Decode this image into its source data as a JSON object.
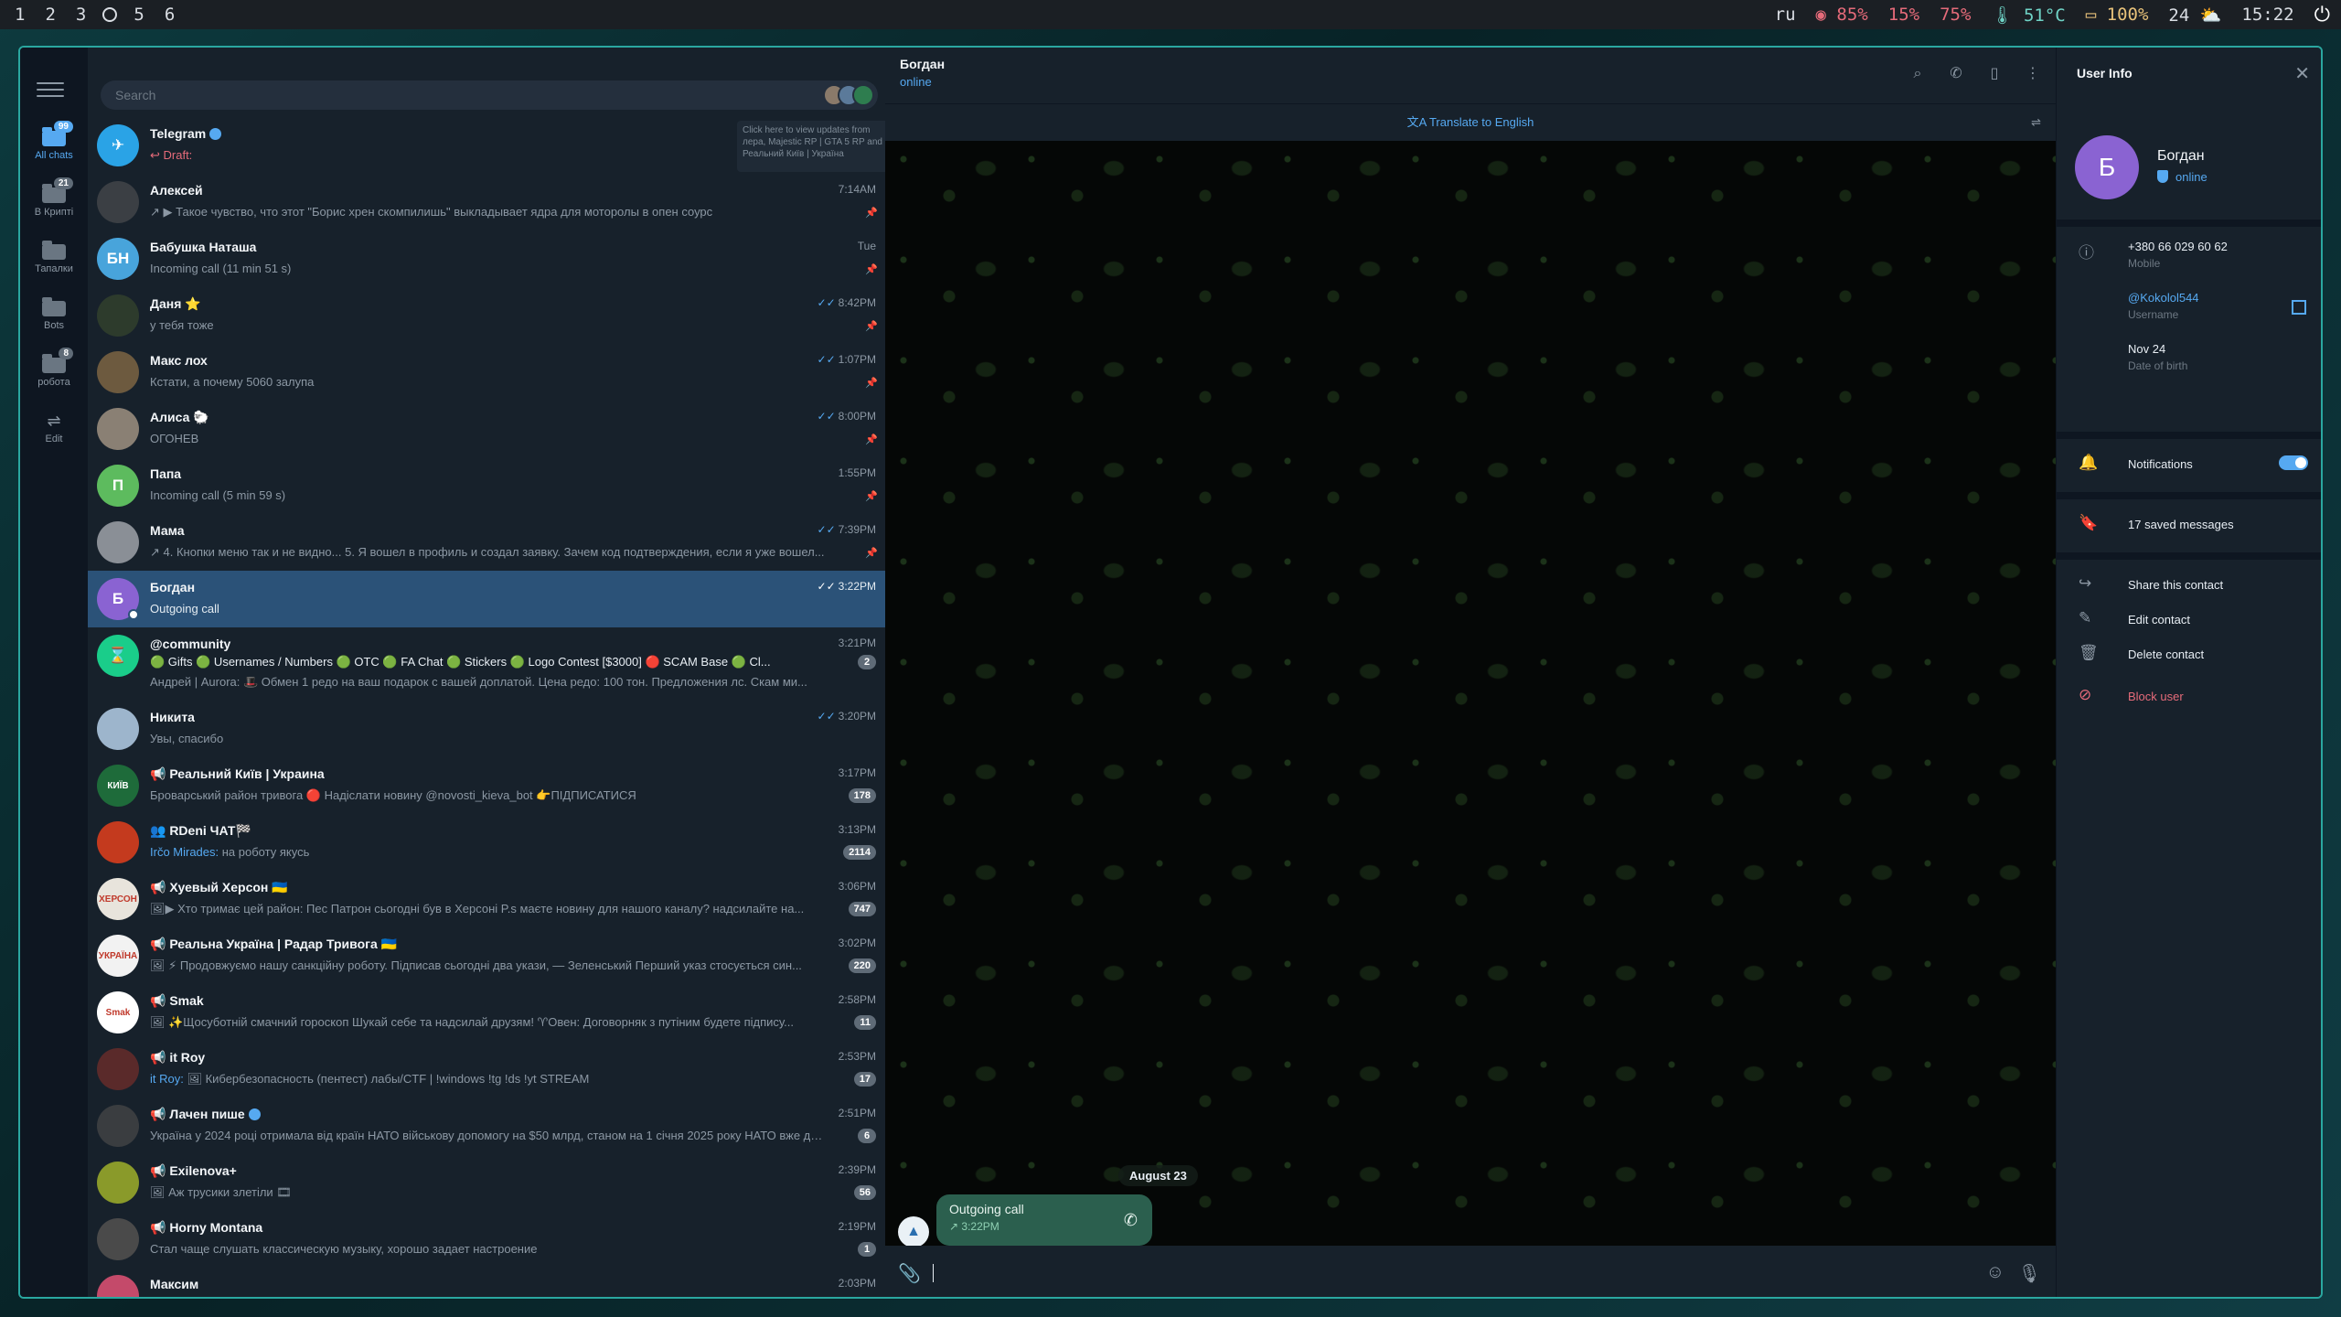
{
  "system_bar": {
    "workspaces": [
      "1",
      "2",
      "3",
      "5",
      "6"
    ],
    "lang": "ru",
    "mem": "85%",
    "cpu": "15%",
    "load": "75%",
    "temp": "51°C",
    "battery": "100%",
    "weather": "24",
    "clock": "15:22"
  },
  "rail": {
    "folders": [
      {
        "label": "All chats",
        "badge": "99",
        "icon": "chat-bubbles-icon"
      },
      {
        "label": "В Крипті",
        "badge": "21",
        "icon": "folder-icon"
      },
      {
        "label": "Тапалки",
        "badge": "",
        "icon": "folder-icon"
      },
      {
        "label": "Bots",
        "badge": "",
        "icon": "folder-icon"
      },
      {
        "label": "робота",
        "badge": "8",
        "icon": "folder-icon"
      },
      {
        "label": "Edit",
        "badge": "",
        "icon": "sliders-icon"
      }
    ]
  },
  "chatlist": {
    "search_placeholder": "Search",
    "tooltip": "Click here to view updates from лера, Majestic RP | GTA 5 RP and Реальний Київ | Україна",
    "rows": [
      {
        "name": "Telegram",
        "time": "",
        "preview": "Draft:",
        "avatar_text": "✈",
        "avatar_color": "#2AA3E6",
        "draft": true,
        "verified": true
      },
      {
        "name": "Алексей",
        "time": "7:14AM",
        "preview": "↗ ▶ Такое чувство, что этот \"Борис хрен скомпилишь\" выкладывает ядра для моторолы в опен соурс",
        "avatar_text": "",
        "avatar_color": "#3b3f44",
        "pinned": true
      },
      {
        "name": "Бабушка Наташа",
        "time": "Tue",
        "preview": "Incoming call (11 min 51 s)",
        "avatar_text": "БН",
        "avatar_color": "#48A4DB",
        "pinned": true
      },
      {
        "name": "Даня ⭐",
        "time": "8:42PM",
        "preview": "у тебя тоже",
        "avatar_text": "",
        "avatar_color": "#2d3b2c",
        "read": true,
        "pinned": true
      },
      {
        "name": "Макс лох",
        "time": "1:07PM",
        "preview": "Кстати, а почему 5060 залупа",
        "avatar_text": "",
        "avatar_color": "#6d5a3f",
        "read": true,
        "pinned": true
      },
      {
        "name": "Алиса 🐑",
        "time": "8:00PM",
        "preview": "ОГОНЕВ",
        "avatar_text": "",
        "avatar_color": "#8a8074",
        "read": true,
        "pinned": true
      },
      {
        "name": "Папа",
        "time": "1:55PM",
        "preview": "Incoming call (5 min 59 s)",
        "avatar_text": "П",
        "avatar_color": "#5DBB5E",
        "pinned": true
      },
      {
        "name": "Мама",
        "time": "7:39PM",
        "preview": "↗ 4. Кнопки меню так и не видно... 5. Я вошел в профиль и создал заявку. Зачем код подтверждения, если я уже вошел...",
        "avatar_text": "",
        "avatar_color": "#8a8f96",
        "read": true,
        "pinned": true
      },
      {
        "name": "Богдан",
        "time": "3:22PM",
        "preview": "Outgoing call",
        "avatar_text": "Б",
        "avatar_color": "#8A63D2",
        "read": true,
        "active": true
      },
      {
        "name": "@community",
        "time": "3:21PM",
        "preview": "Андрей | Aurora: 🎩 Обмен 1 редо на ваш подарок с вашей доплатой. Цена редо: 100 тон. Предложения лс. Скам ми...",
        "topics": "🟢 Gifts  🟢 Usernames / Numbers  🟢 OTC  🟢 FA Chat  🟢 Stickers  🟢 Logo Contest [$3000]  🔴 SCAM Base  🟢 Cl...",
        "avatar_text": "⌛",
        "avatar_color": "#1ACD8A",
        "tall": true,
        "unread": "2"
      },
      {
        "name": "Никита",
        "time": "3:20PM",
        "preview": "Увы, спасибо",
        "avatar_text": "",
        "avatar_color": "#9db5cc",
        "read": true
      },
      {
        "name": "📢 Реальний Київ | Украина",
        "time": "3:17PM",
        "preview": "Броварський район тривога 🔴 Надіслати новину @novosti_kieva_bot 👉ПІДПИСАТИСЯ",
        "avatar_text": "КИЇВ",
        "avatar_color": "#1e6b3a",
        "unread": "178"
      },
      {
        "name": "👥 RDeni ЧАТ🏁",
        "time": "3:13PM",
        "preview": "Irčo Mirades: на роботу якусь",
        "sender": "Irčo Mirades:",
        "avatar_text": "",
        "avatar_color": "#c43a1e",
        "unread": "2114"
      },
      {
        "name": "📢 Хуевый Херсон 🇺🇦",
        "time": "3:06PM",
        "preview": "🖼▶ Хто тримає цей район: Пес Патрон сьогодні був в Херсоні P.s маєте новину для нашого каналу? надсилайте на...",
        "avatar_text": "ХЕРСОН",
        "avatar_color": "#e8e4dc",
        "unread": "747"
      },
      {
        "name": "📢 Реальна Україна | Радар Тривога 🇺🇦",
        "time": "3:02PM",
        "preview": "🖼 ⚡ Продовжуємо нашу санкційну роботу. Підписав сьогодні два укази, — Зеленський Перший указ стосується син...",
        "avatar_text": "УКРАЇНА",
        "avatar_color": "#f2f2f2",
        "unread": "220"
      },
      {
        "name": "📢 Smak",
        "time": "2:58PM",
        "preview": "🖼 ✨Щосуботній смачний гороскоп Шукай себе та надсилай друзям! ♈Овен: Договорняк з путіним будете підпису...",
        "avatar_text": "Smak",
        "avatar_color": "#ffffff",
        "unread": "11"
      },
      {
        "name": "📢 it Roy",
        "time": "2:53PM",
        "preview": "it Roy: 🖼 Кибербезопасность (пентест) лабы/CTF | !windows !tg !ds !yt STREAM",
        "sender": "it Roy:",
        "avatar_text": "",
        "avatar_color": "#5a2a2a",
        "unread": "17"
      },
      {
        "name": "📢 Лачен пише",
        "time": "2:51PM",
        "preview": "Україна у 2024 році отримала від країн НАТО військову допомогу на $50 млрд, станом на 1 січня 2025 року НАТО вже до...",
        "avatar_text": "",
        "avatar_color": "#3a3d40",
        "unread": "6",
        "verified": true
      },
      {
        "name": "📢 Exilenova+",
        "time": "2:39PM",
        "preview": "🖼 Аж трусики злетіли 🎞",
        "avatar_text": "",
        "avatar_color": "#8a9a2a",
        "unread": "56"
      },
      {
        "name": "📢 Horny Montana",
        "time": "2:19PM",
        "preview": "Стал чаще слушать классическую музыку, хорошо задает настроение",
        "avatar_text": "",
        "avatar_color": "#4a4a4a",
        "unread": "1"
      },
      {
        "name": "Максим",
        "time": "2:03PM",
        "preview": "",
        "avatar_text": "",
        "avatar_color": "#c44a6a"
      }
    ]
  },
  "chat": {
    "title": "Богдан",
    "status": "online",
    "translate": "Translate to English",
    "date": "August 23",
    "message": {
      "title": "Outgoing call",
      "time": "3:22PM"
    }
  },
  "info": {
    "title": "User Info",
    "name": "Богдан",
    "avatar_text": "Б",
    "status": "online",
    "phone": "+380 66 029 60 62",
    "phone_label": "Mobile",
    "username": "@Kokolol544",
    "username_label": "Username",
    "birthday": "Nov 24",
    "birthday_label": "Date of birth",
    "notifications": "Notifications",
    "saved": "17 saved messages",
    "share": "Share this contact",
    "edit": "Edit contact",
    "delete": "Delete contact",
    "block": "Block user"
  }
}
